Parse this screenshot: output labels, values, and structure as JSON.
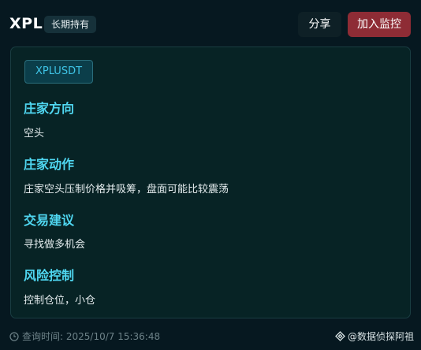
{
  "header": {
    "symbol": "XPL",
    "hold_badge": "长期持有",
    "share_label": "分享",
    "watch_label": "加入监控"
  },
  "card": {
    "pair": "XPLUSDT",
    "sections": [
      {
        "title": "庄家方向",
        "text": "空头"
      },
      {
        "title": "庄家动作",
        "text": "庄家空头压制价格并吸筹，盘面可能比较震荡"
      },
      {
        "title": "交易建议",
        "text": "寻找做多机会"
      },
      {
        "title": "风险控制",
        "text": "控制仓位，小仓"
      }
    ]
  },
  "footer": {
    "query_time": "查询时间: 2025/10/7 15:36:48",
    "brand": "@数据侦探阿祖"
  },
  "colors": {
    "background": "#061820",
    "card": "#072325",
    "accent": "#4fd6f0",
    "watch_button": "#8e2c35"
  },
  "icons": {
    "footer_time": "clock-icon",
    "footer_brand": "binance-logo-icon"
  }
}
